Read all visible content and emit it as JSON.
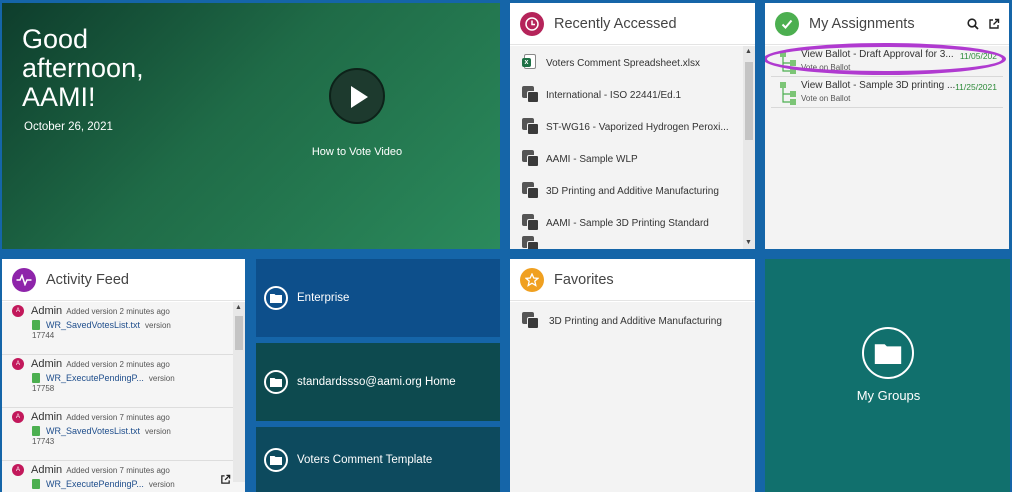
{
  "hero": {
    "greeting": "Good afternoon, AAMI!",
    "date": "October 26, 2021",
    "video_label": "How to Vote Video"
  },
  "recent": {
    "title": "Recently Accessed",
    "items": [
      {
        "label": "Voters Comment Spreadsheet.xlsx",
        "icon": "excel-icon"
      },
      {
        "label": "International - ISO 22441/Ed.1",
        "icon": "workspace-icon"
      },
      {
        "label": "ST-WG16 - Vaporized Hydrogen Peroxi...",
        "icon": "workspace-icon"
      },
      {
        "label": "AAMI - Sample WLP",
        "icon": "workspace-icon"
      },
      {
        "label": "3D Printing and Additive Manufacturing",
        "icon": "workspace-icon"
      },
      {
        "label": "AAMI - Sample 3D Printing Standard",
        "icon": "workspace-icon"
      }
    ]
  },
  "assignments": {
    "title": "My Assignments",
    "items": [
      {
        "label": "View Ballot - Draft Approval for 3...",
        "sub": "Vote on Ballot",
        "date": "11/05/202"
      },
      {
        "label": "View Ballot - Sample 3D printing ...",
        "sub": "Vote on Ballot",
        "date": "11/25/2021"
      }
    ],
    "highlight_color": "#b03ad0"
  },
  "activity": {
    "title": "Activity Feed",
    "items": [
      {
        "avatar": "A",
        "user": "Admin",
        "action": "Added version 2 minutes ago",
        "file": "WR_SavedVotesList.txt",
        "suffix": "version",
        "number": "17744"
      },
      {
        "avatar": "A",
        "user": "Admin",
        "action": "Added version 2 minutes ago",
        "file": "WR_ExecutePendingP...",
        "suffix": "version",
        "number": "17758"
      },
      {
        "avatar": "A",
        "user": "Admin",
        "action": "Added version 7 minutes ago",
        "file": "WR_SavedVotesList.txt",
        "suffix": "version",
        "number": "17743"
      },
      {
        "avatar": "A",
        "user": "Admin",
        "action": "Added version 7 minutes ago",
        "file": "WR_ExecutePendingP...",
        "suffix": "version",
        "number": ""
      }
    ]
  },
  "nav": {
    "enterprise": "Enterprise",
    "home": "standardssso@aami.org Home",
    "template": "Voters Comment Template"
  },
  "favorites": {
    "title": "Favorites",
    "items": [
      {
        "label": "3D Printing and Additive Manufacturing",
        "icon": "workspace-icon"
      }
    ]
  },
  "groups": {
    "label": "My Groups"
  },
  "colors": {
    "background": "#1565a8",
    "recent_accent": "#b5245a",
    "assign_accent": "#4caf50",
    "activity_accent": "#8e24aa",
    "fav_accent": "#f0a020",
    "nav_blue": "#0d4f8b",
    "nav_dark": "#0d4a4f",
    "groups_teal": "#11706d"
  }
}
